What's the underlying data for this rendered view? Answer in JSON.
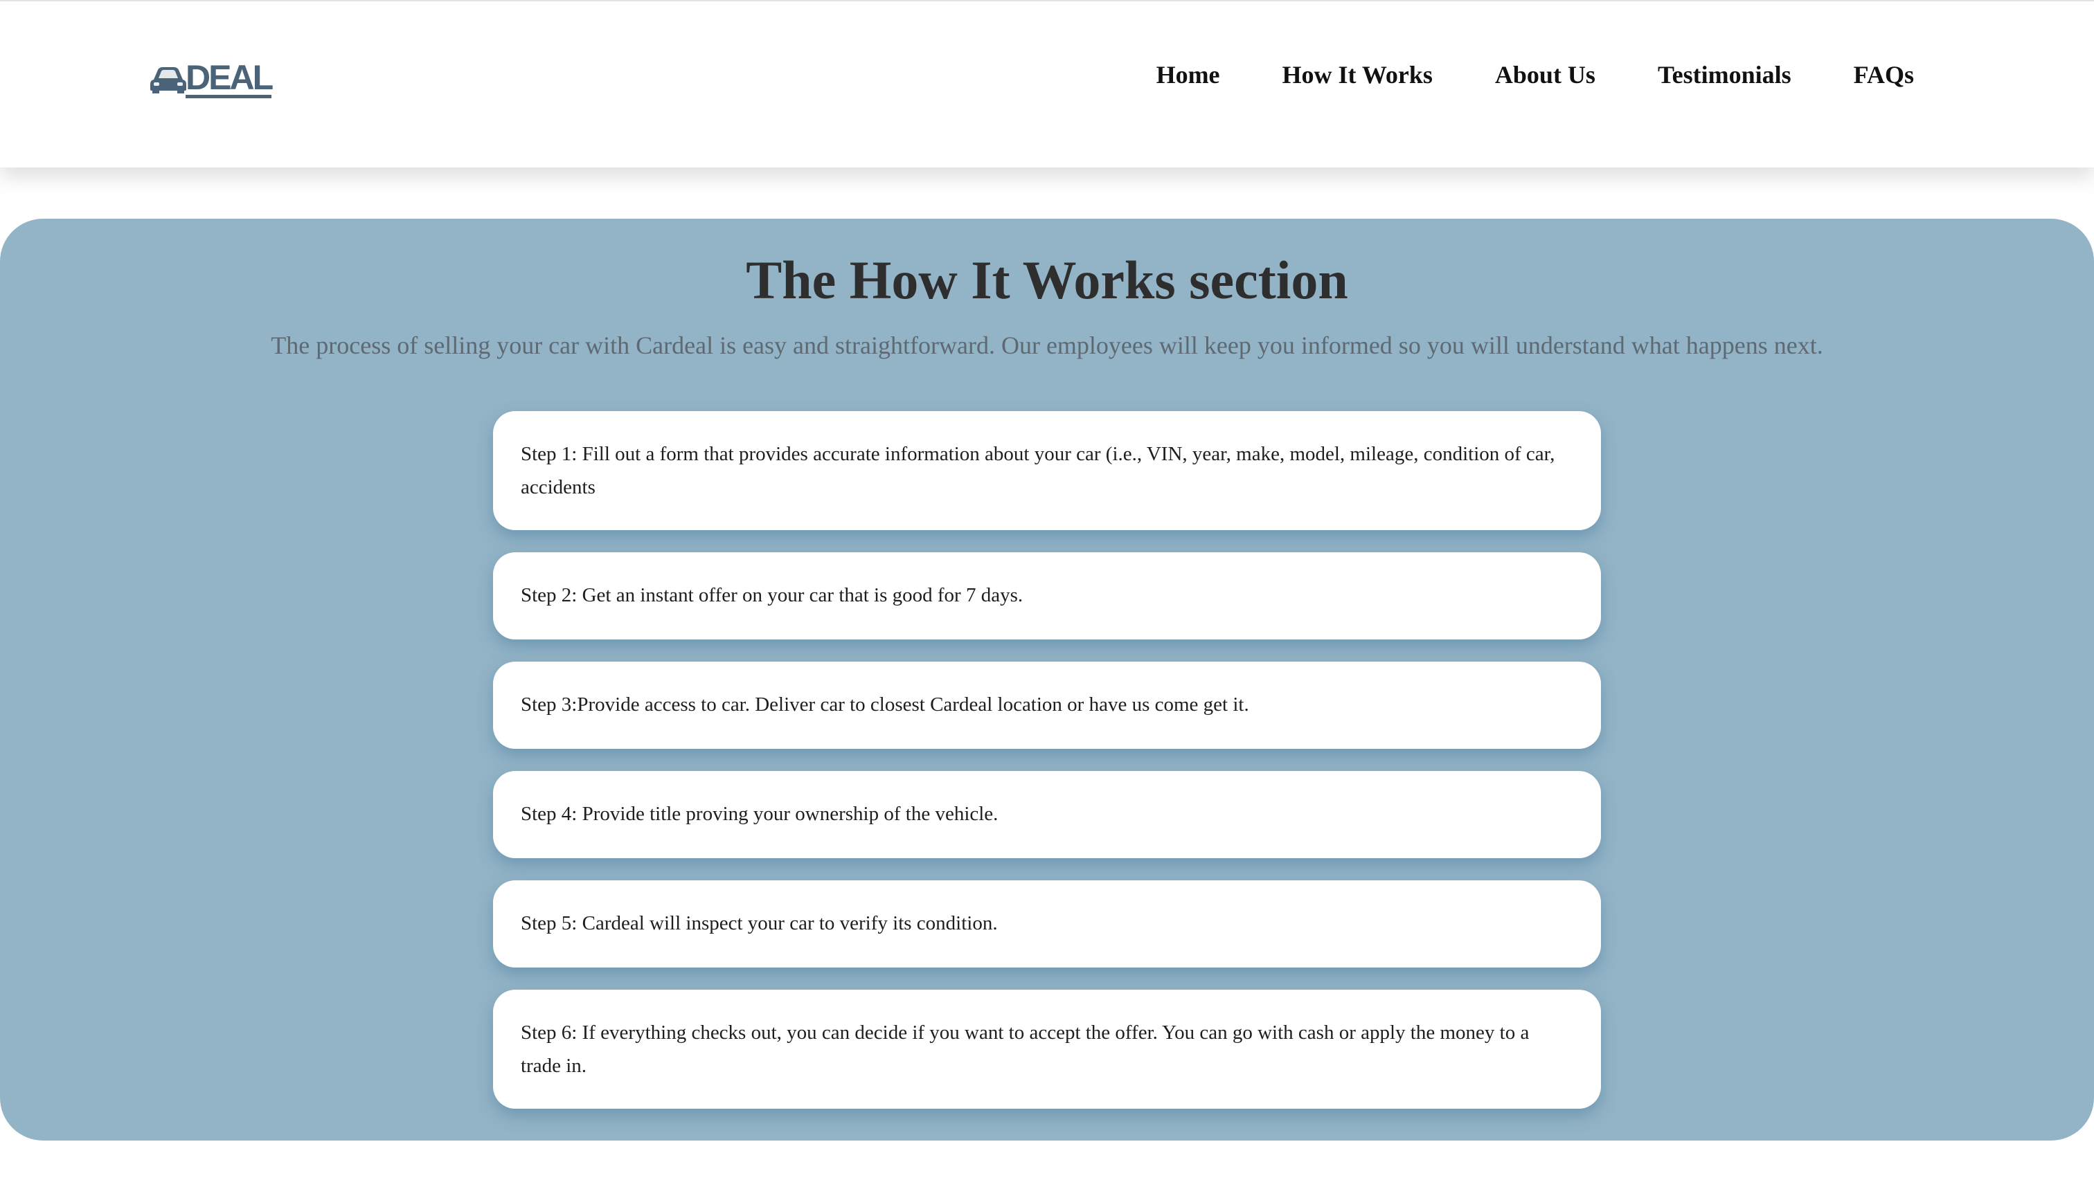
{
  "header": {
    "logo": {
      "text": "DEAL",
      "icon": "car-icon"
    },
    "nav": [
      {
        "label": "Home"
      },
      {
        "label": "How It Works"
      },
      {
        "label": "About Us"
      },
      {
        "label": "Testimonials"
      },
      {
        "label": "FAQs"
      }
    ]
  },
  "how_it_works": {
    "title": "The How It Works section",
    "subtitle": "The process of selling your car with Cardeal is easy and straightforward. Our employees will keep you informed so you will understand what happens next.",
    "steps": [
      {
        "text": "Step 1: Fill out a form that provides accurate information about your car (i.e., VIN, year, make, model, mileage, condition of car, accidents"
      },
      {
        "text": "Step 2: Get an instant offer on your car that is good for 7 days."
      },
      {
        "text": "Step 3:Provide access to car. Deliver car to closest Cardeal location or have us come get it."
      },
      {
        "text": "Step 4: Provide title proving your ownership of the vehicle."
      },
      {
        "text": "Step 5: Cardeal will inspect your car to verify its condition."
      },
      {
        "text": "Step 6: If everything checks out, you can decide if you want to accept the offer. You can go with cash or apply the money to a trade in."
      }
    ]
  },
  "colors": {
    "section_background": "#93b3c6",
    "logo": "#4a6378",
    "card_background": "#ffffff",
    "title_text": "#2e2e2e",
    "subtitle_text": "#5d6a73"
  }
}
